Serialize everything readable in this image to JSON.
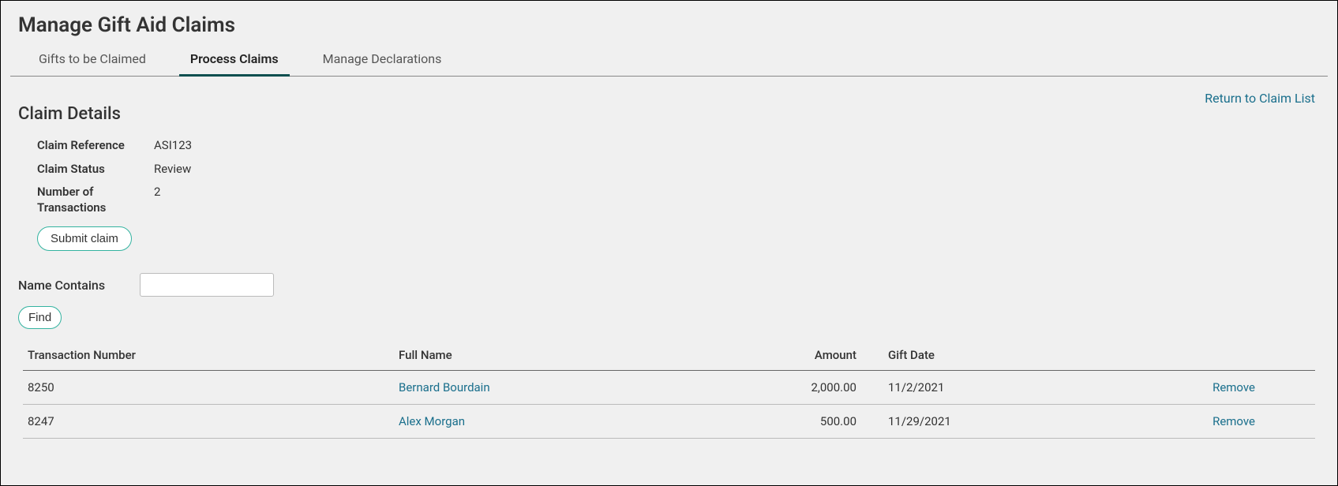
{
  "page_title": "Manage Gift Aid Claims",
  "tabs": [
    {
      "label": "Gifts to be Claimed",
      "active": false
    },
    {
      "label": "Process Claims",
      "active": true
    },
    {
      "label": "Manage Declarations",
      "active": false
    }
  ],
  "return_link": "Return to Claim List",
  "section_title": "Claim Details",
  "details": {
    "claim_reference_label": "Claim Reference",
    "claim_reference_value": "ASI123",
    "claim_status_label": "Claim Status",
    "claim_status_value": "Review",
    "num_transactions_label": "Number of Transactions",
    "num_transactions_value": "2"
  },
  "submit_button": "Submit claim",
  "search": {
    "label": "Name Contains",
    "value": "",
    "find_button": "Find"
  },
  "table": {
    "headers": {
      "txn": "Transaction Number",
      "name": "Full Name",
      "amount": "Amount",
      "gift_date": "Gift Date"
    },
    "rows": [
      {
        "txn": "8250",
        "name": "Bernard Bourdain",
        "amount": "2,000.00",
        "gift_date": "11/2/2021",
        "action": "Remove"
      },
      {
        "txn": "8247",
        "name": "Alex Morgan",
        "amount": "500.00",
        "gift_date": "11/29/2021",
        "action": "Remove"
      }
    ]
  }
}
